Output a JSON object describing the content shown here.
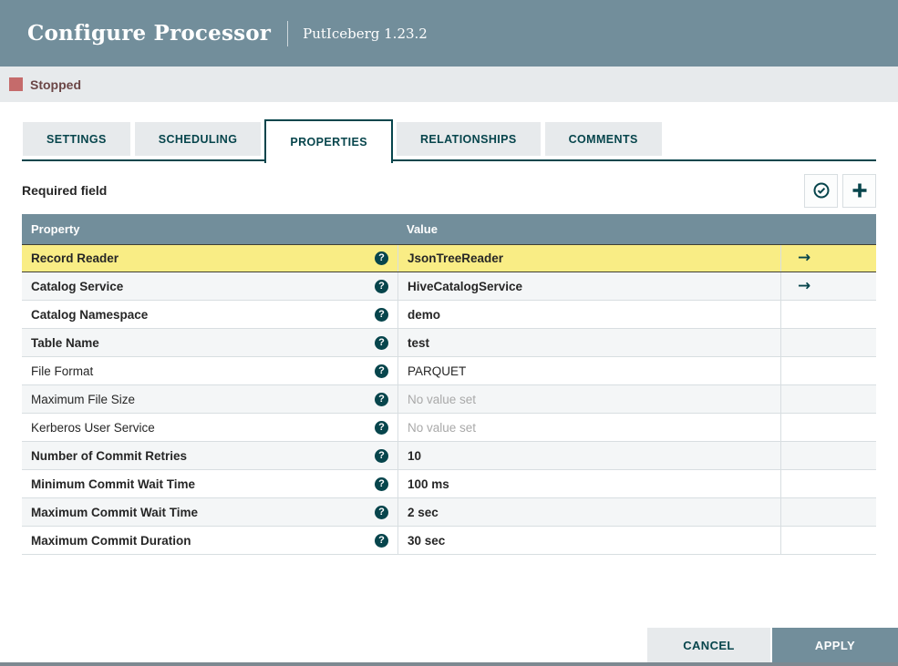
{
  "header": {
    "title": "Configure Processor",
    "subtitle": "PutIceberg 1.23.2"
  },
  "status": {
    "label": "Stopped"
  },
  "tabs": [
    {
      "label": "SETTINGS",
      "active": false
    },
    {
      "label": "SCHEDULING",
      "active": false
    },
    {
      "label": "PROPERTIES",
      "active": true
    },
    {
      "label": "RELATIONSHIPS",
      "active": false
    },
    {
      "label": "COMMENTS",
      "active": false
    }
  ],
  "toolbar": {
    "required_label": "Required field",
    "verify_icon": "check-circle-icon",
    "add_icon": "plus-icon"
  },
  "table": {
    "columns": {
      "property": "Property",
      "value": "Value"
    },
    "help_glyph": "?",
    "goto_glyph": "→",
    "rows": [
      {
        "property": "Record Reader",
        "value": "JsonTreeReader",
        "required": true,
        "selected": true,
        "go_to": true,
        "unset": false
      },
      {
        "property": "Catalog Service",
        "value": "HiveCatalogService",
        "required": true,
        "selected": false,
        "go_to": true,
        "unset": false
      },
      {
        "property": "Catalog Namespace",
        "value": "demo",
        "required": true,
        "selected": false,
        "go_to": false,
        "unset": false
      },
      {
        "property": "Table Name",
        "value": "test",
        "required": true,
        "selected": false,
        "go_to": false,
        "unset": false
      },
      {
        "property": "File Format",
        "value": "PARQUET",
        "required": false,
        "selected": false,
        "go_to": false,
        "unset": false
      },
      {
        "property": "Maximum File Size",
        "value": "No value set",
        "required": false,
        "selected": false,
        "go_to": false,
        "unset": true
      },
      {
        "property": "Kerberos User Service",
        "value": "No value set",
        "required": false,
        "selected": false,
        "go_to": false,
        "unset": true
      },
      {
        "property": "Number of Commit Retries",
        "value": "10",
        "required": true,
        "selected": false,
        "go_to": false,
        "unset": false
      },
      {
        "property": "Minimum Commit Wait Time",
        "value": "100 ms",
        "required": true,
        "selected": false,
        "go_to": false,
        "unset": false
      },
      {
        "property": "Maximum Commit Wait Time",
        "value": "2 sec",
        "required": true,
        "selected": false,
        "go_to": false,
        "unset": false
      },
      {
        "property": "Maximum Commit Duration",
        "value": "30 sec",
        "required": true,
        "selected": false,
        "go_to": false,
        "unset": false
      }
    ]
  },
  "footer": {
    "cancel_label": "CANCEL",
    "apply_label": "APPLY"
  },
  "colors": {
    "header_slate": "#728E9B",
    "accent_teal": "#07454C",
    "selected_row_yellow": "#F9ED85",
    "stopped_red": "#C56B6B",
    "panel_grey": "#E7EAEC",
    "row_stripe": "#F4F6F7",
    "muted_text": "#A9A9A9"
  }
}
